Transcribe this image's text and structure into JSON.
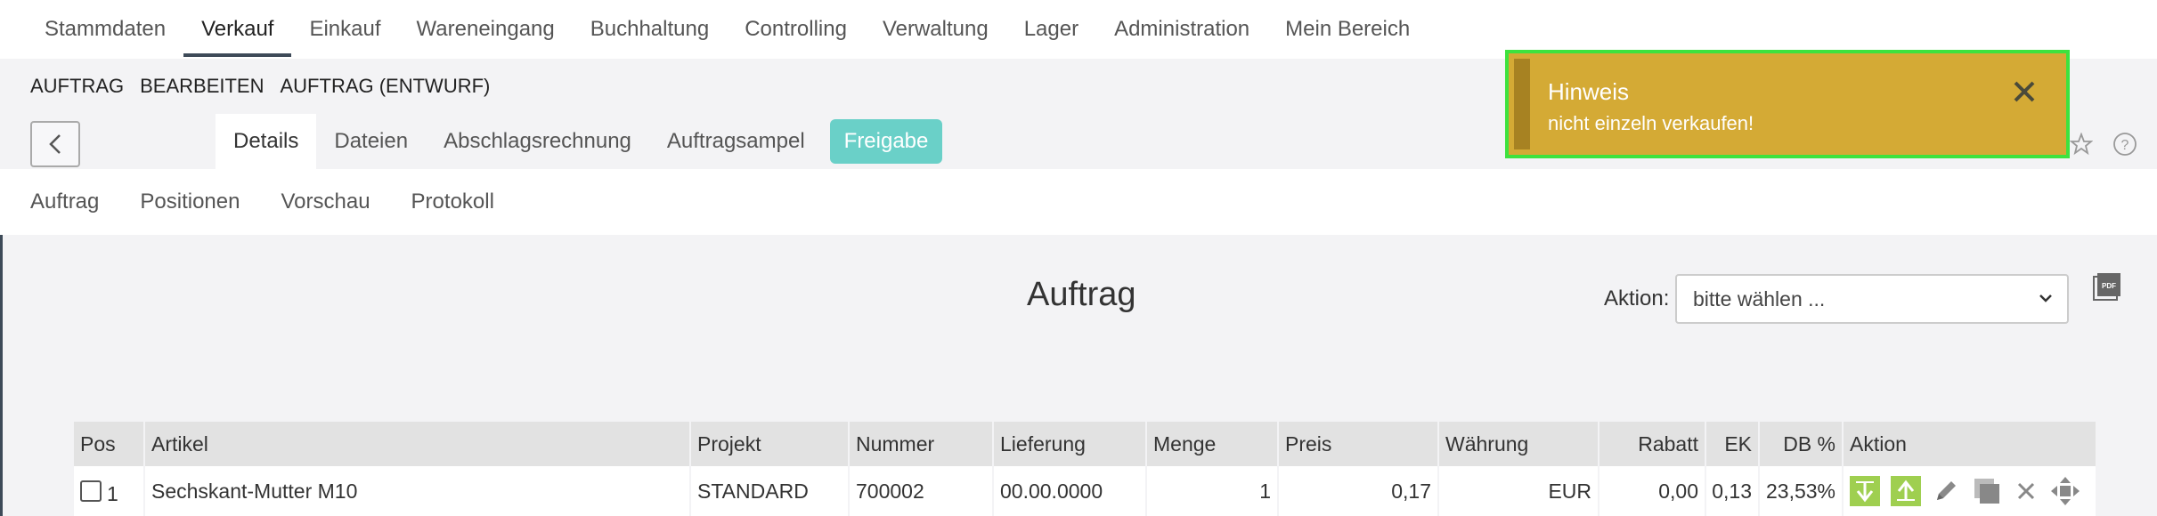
{
  "topnav": {
    "items": [
      "Stammdaten",
      "Verkauf",
      "Einkauf",
      "Wareneingang",
      "Buchhaltung",
      "Controlling",
      "Verwaltung",
      "Lager",
      "Administration",
      "Mein Bereich"
    ],
    "active": "Verkauf"
  },
  "breadcrumb": [
    "AUFTRAG",
    "BEARBEITEN",
    "AUFTRAG (ENTWURF)"
  ],
  "tabs": [
    "Details",
    "Dateien",
    "Abschlagsrechnung",
    "Auftragsampel",
    "Freigabe"
  ],
  "subnav": [
    "Auftrag",
    "Positionen",
    "Vorschau",
    "Protokoll"
  ],
  "page_title": "Auftrag",
  "aktion": {
    "label": "Aktion:",
    "value": "bitte wählen ..."
  },
  "table": {
    "headers": [
      "Pos",
      "Artikel",
      "Projekt",
      "Nummer",
      "Lieferung",
      "Menge",
      "Preis",
      "Währung",
      "Rabatt",
      "EK",
      "DB %",
      "Aktion"
    ],
    "rows": [
      {
        "pos": "1",
        "artikel": "Sechskant-Mutter M10",
        "projekt": "STANDARD",
        "nummer": "700002",
        "lieferung": "00.00.0000",
        "menge": "1",
        "preis": "0,17",
        "waehrung": "EUR",
        "rabatt": "0,00",
        "ek": "0,13",
        "db": "23,53%"
      }
    ]
  },
  "toast": {
    "title": "Hinweis",
    "message": "nicht einzeln verkaufen!"
  },
  "colors": {
    "toast_bg": "#d4aa35",
    "highlight": "#3ee23e",
    "freigabe": "#6ad0c8",
    "action_green": "#9fcf50"
  }
}
